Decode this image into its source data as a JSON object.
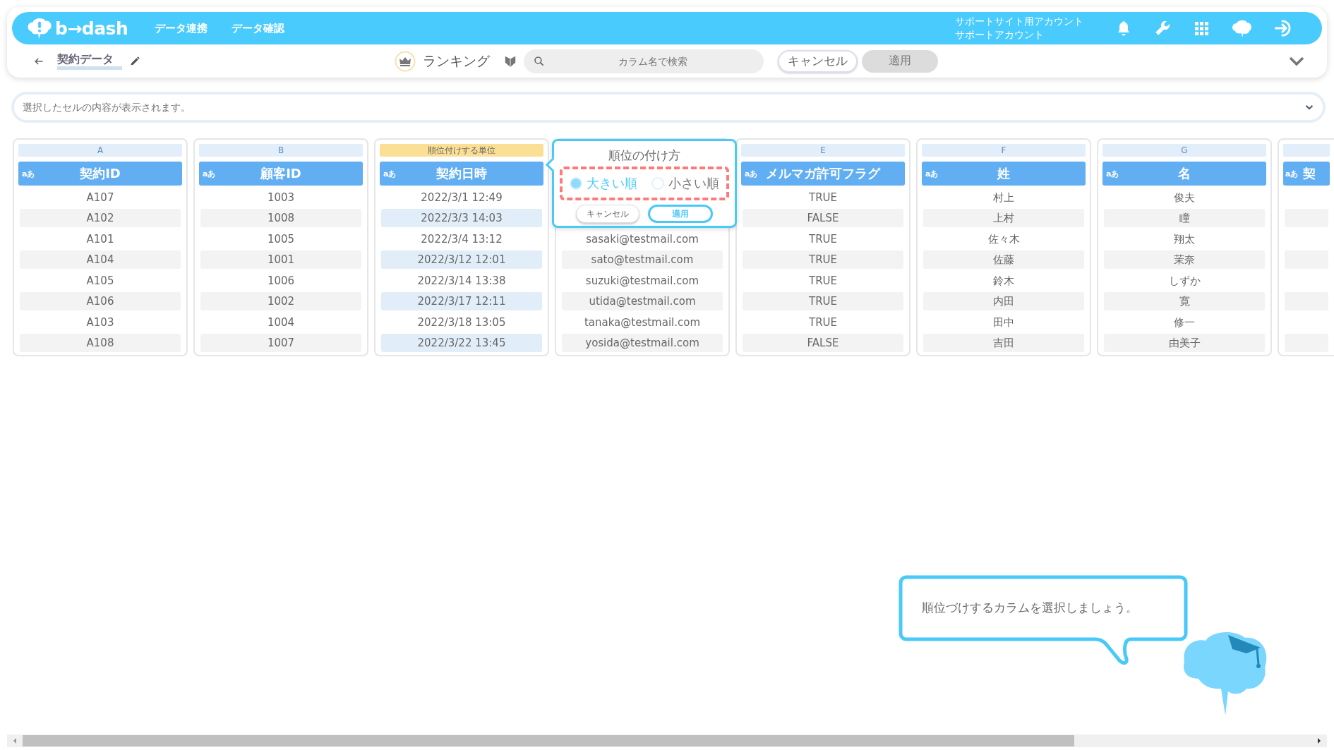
{
  "header": {
    "logo": "b→dash",
    "nav": [
      {
        "label": "データ連携"
      },
      {
        "label": "データ確認"
      }
    ],
    "account_lines": [
      "サポートサイト用アカウント",
      "サポートアカウント"
    ]
  },
  "toolbar": {
    "title": "契約データ",
    "mode_label": "ランキング",
    "search": {
      "placeholder": "カラム名で検索"
    },
    "cancel": "キャンセル",
    "apply": {
      "label": "適用",
      "disabled": true
    }
  },
  "cell_display": {
    "placeholder": "選択したセルの内容が表示されます。"
  },
  "columns": [
    {
      "letter": "A",
      "type_label": "aあ",
      "name": "契約ID",
      "selected": false,
      "rows": [
        "A107",
        "A102",
        "A101",
        "A104",
        "A105",
        "A106",
        "A103",
        "A108"
      ]
    },
    {
      "letter": "B",
      "type_label": "aあ",
      "name": "顧客ID",
      "selected": false,
      "rows": [
        "1003",
        "1008",
        "1005",
        "1001",
        "1006",
        "1002",
        "1004",
        "1007"
      ]
    },
    {
      "letter": "順位付けする単位",
      "type_label": "aあ",
      "name": "契約日時",
      "selected": true,
      "rows": [
        "2022/3/1 12:49",
        "2022/3/3 14:03",
        "2022/3/4 13:12",
        "2022/3/12 12:01",
        "2022/3/14 13:38",
        "2022/3/17 12:11",
        "2022/3/18 13:05",
        "2022/3/22 13:45"
      ]
    },
    {
      "selected": false,
      "rows": [
        "sasaki@testmail.com",
        "sato@testmail.com",
        "suzuki@testmail.com",
        "utida@testmail.com",
        "tanaka@testmail.com",
        "yosida@testmail.com"
      ]
    },
    {
      "letter": "E",
      "type_label": "aあ",
      "name": "メルマガ許可フラグ",
      "selected": false,
      "rows": [
        "TRUE",
        "FALSE",
        "TRUE",
        "TRUE",
        "TRUE",
        "TRUE",
        "TRUE",
        "FALSE"
      ]
    },
    {
      "letter": "F",
      "type_label": "aあ",
      "name": "姓",
      "selected": false,
      "rows": [
        "村上",
        "上村",
        "佐々木",
        "佐藤",
        "鈴木",
        "内田",
        "田中",
        "吉田"
      ]
    },
    {
      "letter": "G",
      "type_label": "aあ",
      "name": "名",
      "selected": false,
      "rows": [
        "俊夫",
        "瞳",
        "翔太",
        "茉奈",
        "しずか",
        "寛",
        "修一",
        "由美子"
      ]
    },
    {
      "type_label": "aあ",
      "name": "契",
      "selected": false
    }
  ],
  "popover": {
    "title": "順位の付け方",
    "options": [
      {
        "label": "大きい順",
        "selected": true
      },
      {
        "label": "小さい順",
        "selected": false
      }
    ],
    "cancel": "キャンセル",
    "apply": "適用"
  },
  "guide": {
    "message": "順位づけするカラムを選択しましょう。"
  }
}
